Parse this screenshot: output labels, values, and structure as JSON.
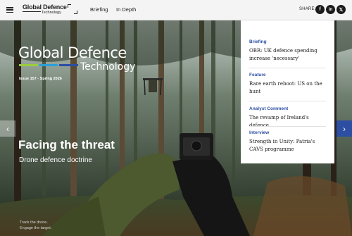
{
  "header": {
    "logo_line1": "Global Defence",
    "logo_line2": "Technology",
    "nav": [
      "Briefing",
      "In Depth"
    ],
    "share_label": "SHARE:",
    "social_icons": [
      "facebook-icon",
      "linkedin-icon",
      "x-icon"
    ],
    "social_glyphs": [
      "f",
      "in",
      "𝕏"
    ]
  },
  "cover": {
    "title_line1": "Global Defence",
    "title_line2": "Technology",
    "issue": "Issue 157 - Spring 2026",
    "headline": "Facing the threat",
    "subheadline": "Drone defence doctrine",
    "tagline_1": "Track the drone.",
    "tagline_2": "Engage the target.",
    "bar_colors": [
      "#9ccc3c",
      "#2aa0d8",
      "#2c4fa3"
    ]
  },
  "carousel": {
    "prev_glyph": "‹",
    "next_glyph": "›"
  },
  "contents": [
    {
      "category": "Briefing",
      "title": "OBR: UK defence spending increase 'necessary'"
    },
    {
      "category": "Feature",
      "title": "Rare earth reboot: US on the hunt"
    },
    {
      "category": "Analyst Comment",
      "title": "The revamp of Ireland's defence"
    },
    {
      "category": "Interview",
      "title": "Strength in Unity: Patria's CAVS programme"
    }
  ],
  "colors": {
    "accent": "#2c4fa3",
    "topbar": "#f4f4f4"
  }
}
